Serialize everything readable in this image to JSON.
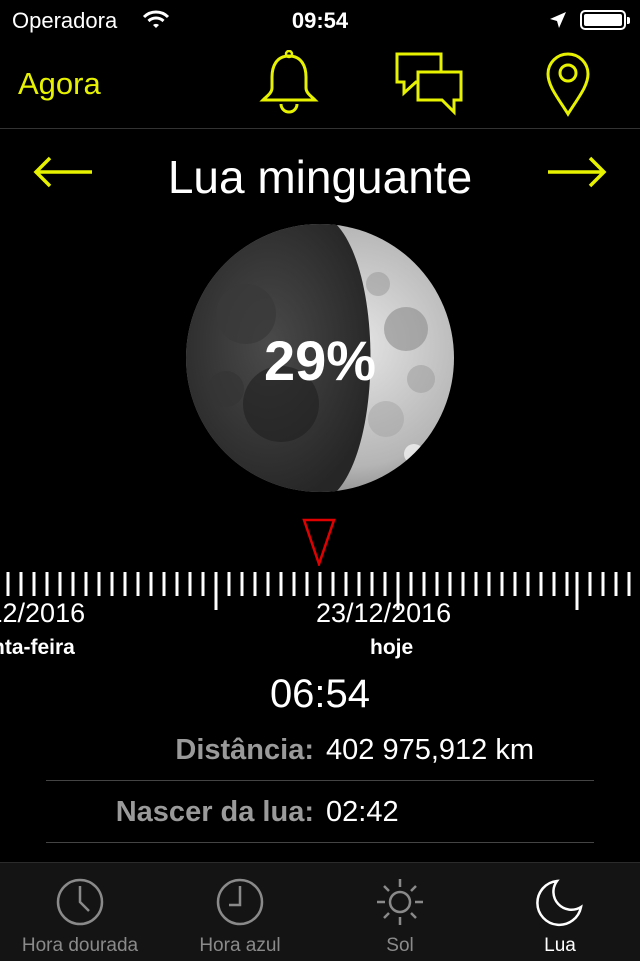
{
  "status": {
    "carrier": "Operadora",
    "time": "09:54"
  },
  "toolbar": {
    "now_label": "Agora",
    "icons": [
      "bell-icon",
      "chat-bubbles-icon",
      "location-pin-icon"
    ],
    "accent": "#e6f200"
  },
  "phase": {
    "title": "Lua minguante",
    "illumination": "29%"
  },
  "timeline": {
    "left_date": "/12/2016",
    "left_day": "nta-feira",
    "center_date": "23/12/2016",
    "center_day": "hoje",
    "marker_color": "#e00000"
  },
  "time": {
    "display": "06:54"
  },
  "info": {
    "distance_label": "Distância:",
    "distance_value": "402 975,912 km",
    "moonrise_label": "Nascer da lua:",
    "moonrise_value": "02:42"
  },
  "tabs": [
    {
      "label": "Hora dourada",
      "icon": "clock-icon"
    },
    {
      "label": "Hora azul",
      "icon": "clock-icon"
    },
    {
      "label": "Sol",
      "icon": "sun-icon"
    },
    {
      "label": "Lua",
      "icon": "moon-icon"
    }
  ]
}
